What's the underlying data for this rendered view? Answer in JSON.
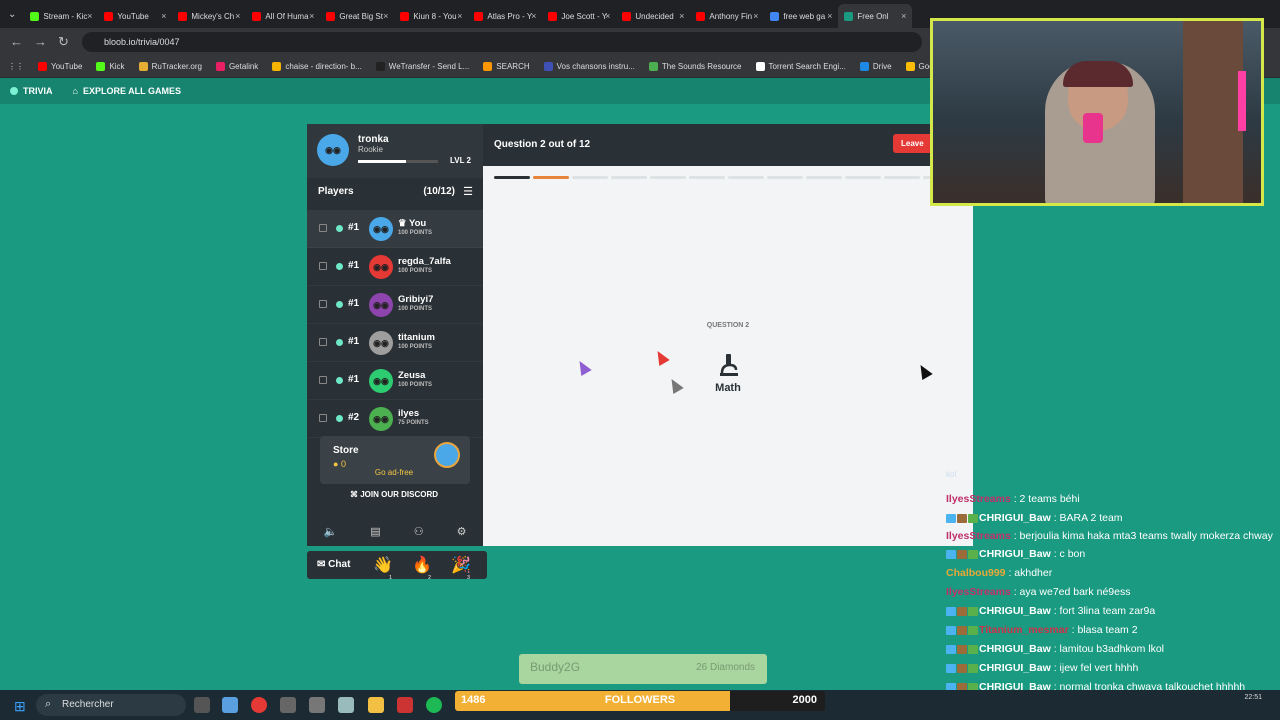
{
  "browser": {
    "tabs": [
      {
        "label": "Stream - Kic",
        "color": "#53fc18"
      },
      {
        "label": "YouTube",
        "color": "#ff0000"
      },
      {
        "label": "Mickey's Ch",
        "color": "#ff0000"
      },
      {
        "label": "All Of Huma",
        "color": "#ff0000"
      },
      {
        "label": "Great Big St",
        "color": "#ff0000"
      },
      {
        "label": "Kiun 8 - You",
        "color": "#ff0000"
      },
      {
        "label": "Atlas Pro - Y",
        "color": "#ff0000"
      },
      {
        "label": "Joe Scott - Y",
        "color": "#ff0000"
      },
      {
        "label": "Undecided",
        "color": "#ff0000"
      },
      {
        "label": "Anthony Fin",
        "color": "#ff0000"
      },
      {
        "label": "free web ga",
        "color": "#4285f4"
      },
      {
        "label": "Free Onl",
        "color": "#1a9a80"
      }
    ],
    "url": "bloob.io/trivia/0047",
    "bookmarks": [
      {
        "label": "YouTube",
        "color": "#ff0000"
      },
      {
        "label": "Kick",
        "color": "#53fc18"
      },
      {
        "label": "RuTracker.org",
        "color": "#e6ad35"
      },
      {
        "label": "Getalink",
        "color": "#e91e63"
      },
      {
        "label": "chaise - direction- b...",
        "color": "#f4b400"
      },
      {
        "label": "WeTransfer - Send L...",
        "color": "#222222"
      },
      {
        "label": "SEARCH",
        "color": "#ff9800"
      },
      {
        "label": "Vos chansons instru...",
        "color": "#3f51b5"
      },
      {
        "label": "The Sounds Resource",
        "color": "#4caf50"
      },
      {
        "label": "Torrent Search Engi...",
        "color": "#ffffff"
      },
      {
        "label": "Drive",
        "color": "#1e88e5"
      },
      {
        "label": "Google Kee",
        "color": "#fbbc04"
      }
    ]
  },
  "gamebar": {
    "trivia": "TRIVIA",
    "explore": "EXPLORE ALL GAMES"
  },
  "profile": {
    "name": "tronka",
    "rank": "Rookie",
    "level": "LVL 2",
    "xp_fraction": 0.6
  },
  "players": {
    "heading": "Players",
    "count": "(10/12)",
    "list": [
      {
        "rank": "#1",
        "name": "♛ You",
        "points": "100 POINTS",
        "color": "#4aa8e8"
      },
      {
        "rank": "#1",
        "name": "regda_7alfa",
        "points": "100 POINTS",
        "color": "#e53935"
      },
      {
        "rank": "#1",
        "name": "Gribiyi7",
        "points": "100 POINTS",
        "color": "#8e44ad"
      },
      {
        "rank": "#1",
        "name": "titanium",
        "points": "100 POINTS",
        "color": "#9e9e9e"
      },
      {
        "rank": "#1",
        "name": "Zeusa",
        "points": "100 POINTS",
        "color": "#2ecc71"
      },
      {
        "rank": "#2",
        "name": "ilyes",
        "points": "75 POINTS",
        "color": "#4caf50"
      }
    ]
  },
  "store": {
    "title": "Store",
    "coins": "0",
    "adfree": "Go ad-free",
    "discord": "JOIN OUR DISCORD"
  },
  "chat_bar": {
    "label": "Chat",
    "emotes": [
      {
        "glyph": "👋",
        "key": "1"
      },
      {
        "glyph": "🔥",
        "key": "2"
      },
      {
        "glyph": "🎉",
        "key": "3"
      }
    ]
  },
  "question": {
    "title": "Question 2 out of 12",
    "leave": "Leave",
    "label": "QUESTION 2",
    "category": "Math",
    "total": 12,
    "current": 2,
    "done_color": "#2a3136",
    "current_color": "#e8833a"
  },
  "twitch_chat": [
    {
      "user": "IlyesStreams",
      "color": "#c0306b",
      "badges": 0,
      "text": ": 2 teams béhi"
    },
    {
      "user": "CHRIGUI_Baw",
      "color": "#ffffff",
      "badges": 3,
      "text": ": BARA 2 team"
    },
    {
      "user": "IlyesStreams",
      "color": "#c0306b",
      "badges": 0,
      "text": ": berjoulia kima haka mta3 teams twally mokerza chway",
      "wrap": true
    },
    {
      "user": "CHRIGUI_Baw",
      "color": "#ffffff",
      "badges": 3,
      "text": ": c bon"
    },
    {
      "user": "Chalbou999",
      "color": "#e8a838",
      "badges": 0,
      "text": ": akhdher"
    },
    {
      "user": "IlyesStreams",
      "color": "#c0306b",
      "badges": 0,
      "text": ": aya we7ed bark né9ess"
    },
    {
      "user": "CHRIGUI_Baw",
      "color": "#ffffff",
      "badges": 3,
      "text": ": fort 3lina team zar9a"
    },
    {
      "user": "Titanium_mesmar",
      "color": "#d0304a",
      "badges": 3,
      "text": ": blasa team 2"
    },
    {
      "user": "CHRIGUI_Baw",
      "color": "#ffffff",
      "badges": 3,
      "text": ": lamitou b3adhkom lkol"
    },
    {
      "user": "CHRIGUI_Baw",
      "color": "#ffffff",
      "badges": 3,
      "text": ": ijew fel vert hhhh"
    },
    {
      "user": "CHRIGUI_Baw",
      "color": "#ffffff",
      "badges": 3,
      "text": ": normal tronka chwaya talkouchet hhhhh"
    }
  ],
  "stray_text": "kol",
  "donation": {
    "name": "Buddy2G",
    "amount": "26 Diamonds"
  },
  "followers": {
    "current": "1486",
    "label": "FOLLOWERS",
    "goal": "2000",
    "progress": 0.743
  },
  "taskbar": {
    "search_placeholder": "Rechercher",
    "time": "22:51"
  }
}
